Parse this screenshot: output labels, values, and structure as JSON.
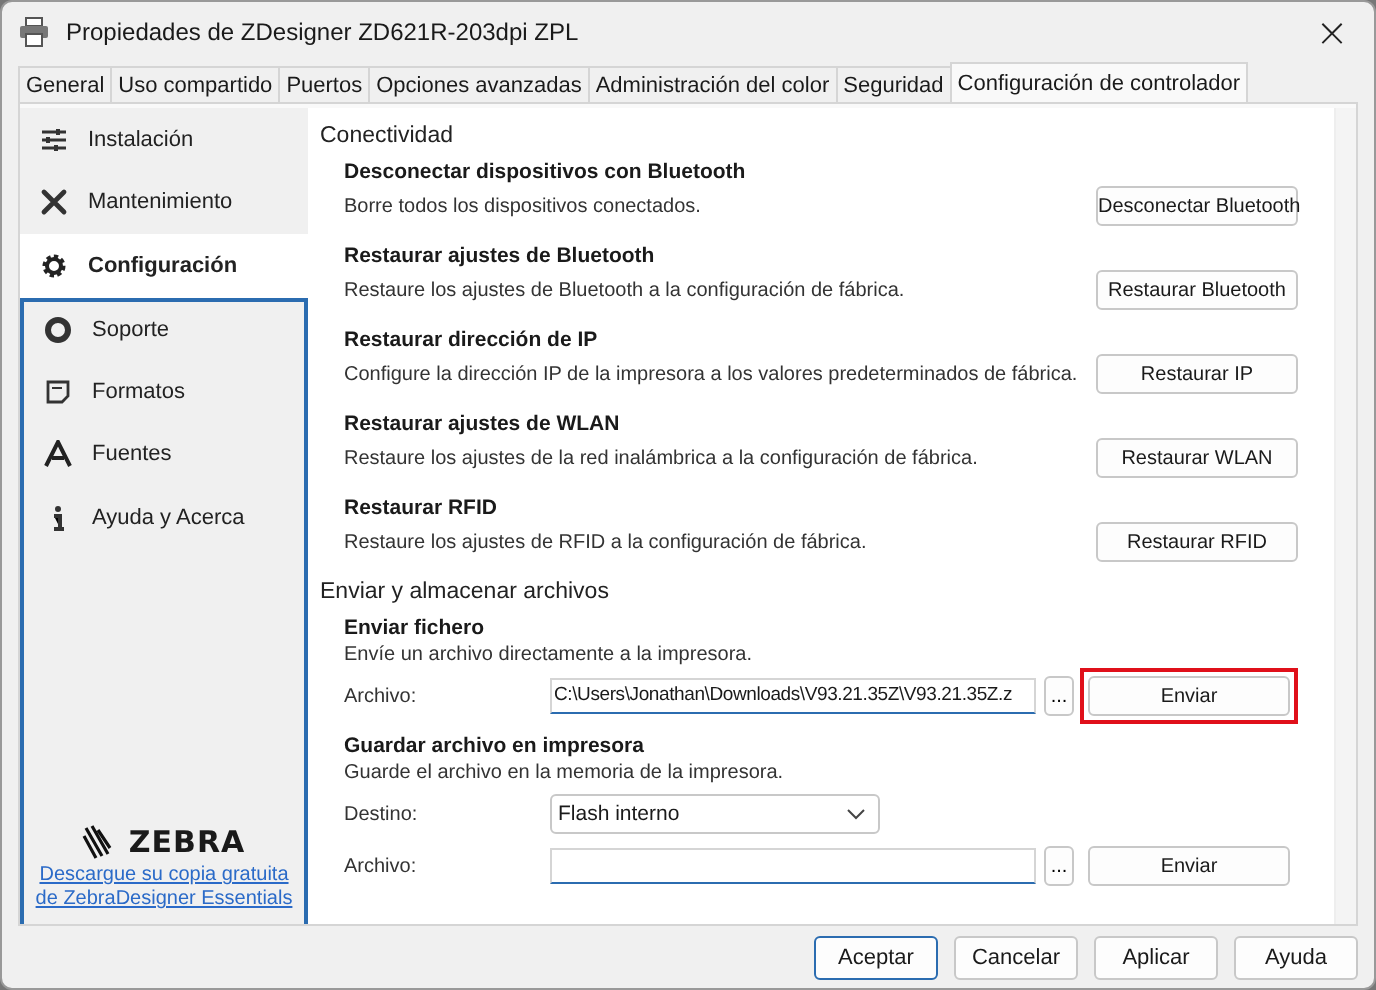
{
  "window": {
    "title": "Propiedades de ZDesigner ZD621R-203dpi ZPL",
    "close": "×"
  },
  "tabs": [
    {
      "label": "General",
      "selected": false
    },
    {
      "label": "Uso compartido",
      "selected": false
    },
    {
      "label": "Puertos",
      "selected": false
    },
    {
      "label": "Opciones avanzadas",
      "selected": false
    },
    {
      "label": "Administración del color",
      "selected": false
    },
    {
      "label": "Seguridad",
      "selected": false
    },
    {
      "label": "Configuración de controlador",
      "selected": true
    }
  ],
  "sidebar": {
    "items": [
      {
        "label": "Instalación",
        "selected": false
      },
      {
        "label": "Mantenimiento",
        "selected": false
      },
      {
        "label": "Configuración",
        "selected": true
      },
      {
        "label": "Soporte",
        "selected": false
      },
      {
        "label": "Formatos",
        "selected": false
      },
      {
        "label": "Fuentes",
        "selected": false
      },
      {
        "label": "Ayuda y Acerca",
        "selected": false
      }
    ],
    "logo": "ZEBRA",
    "link": "Descargue su copia gratuita de ZebraDesigner Essentials"
  },
  "sections": [
    {
      "title": "Conectividad",
      "items": [
        {
          "kind": "action",
          "title": "Desconectar dispositivos con Bluetooth",
          "description": "Borre todos los dispositivos conectados.",
          "button": "Desconectar Bluetooth"
        },
        {
          "kind": "action",
          "title": "Restaurar ajustes de Bluetooth",
          "description": "Restaure los ajustes de Bluetooth a la configuración de fábrica.",
          "button": "Restaurar Bluetooth"
        },
        {
          "kind": "action",
          "title": "Restaurar dirección de IP",
          "description": "Configure la dirección IP de la impresora a los valores predeterminados de fábrica.",
          "button": "Restaurar IP"
        },
        {
          "kind": "action",
          "title": "Restaurar ajustes de WLAN",
          "description": "Restaure los ajustes de la red inalámbrica a la configuración de fábrica.",
          "button": "Restaurar WLAN"
        },
        {
          "kind": "action",
          "title": "Restaurar RFID",
          "description": "Restaure los ajustes de RFID a la configuración de fábrica.",
          "button": "Restaurar RFID"
        }
      ]
    },
    {
      "title": "Enviar y almacenar archivos",
      "items": [
        {
          "kind": "file",
          "title": "Enviar fichero",
          "description": "Envíe un archivo directamente a la impresora.",
          "fields": [
            {
              "kind": "file",
              "label": "Archivo:",
              "value": "C:\\Users\\Jonathan\\Downloads\\V93.21.35Z\\V93.21.35Z.z",
              "browse": "...",
              "button": "Enviar",
              "highlighted": true
            }
          ]
        },
        {
          "kind": "file",
          "title": "Guardar archivo en impresora",
          "description": "Guarde el archivo en la memoria de la impresora.",
          "fields": [
            {
              "kind": "select",
              "label": "Destino:",
              "value": "Flash interno"
            },
            {
              "kind": "file",
              "label": "Archivo:",
              "browse": "...",
              "button": "Enviar",
              "highlighted": false
            }
          ]
        }
      ]
    }
  ],
  "buttons": [
    {
      "label": "Aceptar",
      "default": true
    },
    {
      "label": "Cancelar",
      "default": false
    },
    {
      "label": "Aplicar",
      "default": false
    },
    {
      "label": "Ayuda",
      "default": false
    }
  ]
}
